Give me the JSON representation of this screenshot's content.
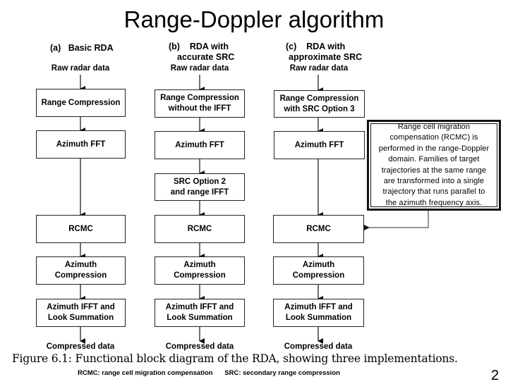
{
  "title": "Range-Doppler algorithm",
  "columns": [
    {
      "label_prefix": "(a)",
      "label_line1": "Basic RDA",
      "label_line2": "",
      "input": "Raw radar data",
      "steps": [
        "Range Compression",
        "Azimuth FFT",
        "RCMC",
        "Azimuth Compression",
        "Azimuth IFFT and Look Summation"
      ],
      "output": "Compressed data"
    },
    {
      "label_prefix": "(b)",
      "label_line1": "RDA with",
      "label_line2": "accurate SRC",
      "input": "Raw radar data",
      "steps": [
        "Range Compression without the IFFT",
        "Azimuth FFT",
        "SRC Option 2 and range IFFT",
        "RCMC",
        "Azimuth Compression",
        "Azimuth IFFT and Look Summation"
      ],
      "output": "Compressed data"
    },
    {
      "label_prefix": "(c)",
      "label_line1": "RDA with",
      "label_line2": "approximate SRC",
      "input": "Raw radar data",
      "steps": [
        "Range Compression with SRC Option 3",
        "Azimuth FFT",
        "RCMC",
        "Azimuth Compression",
        "Azimuth IFFT and Look Summation"
      ],
      "output": "Compressed data"
    }
  ],
  "boxes": {
    "a": {
      "range_compression": "Range Compression",
      "azimuth_fft": "Azimuth FFT",
      "rcmc": "RCMC",
      "azimuth_compression_1": "Azimuth",
      "azimuth_compression_2": "Compression",
      "ifft_1": "Azimuth IFFT and",
      "ifft_2": "Look Summation"
    },
    "b": {
      "range_compression_1": "Range Compression",
      "range_compression_2": "without the IFFT",
      "azimuth_fft": "Azimuth FFT",
      "src_1": "SRC Option 2",
      "src_2": "and range IFFT",
      "rcmc": "RCMC",
      "azimuth_compression_1": "Azimuth",
      "azimuth_compression_2": "Compression",
      "ifft_1": "Azimuth IFFT and",
      "ifft_2": "Look Summation"
    },
    "c": {
      "range_compression_1": "Range Compression",
      "range_compression_2": "with SRC Option 3",
      "azimuth_fft": "Azimuth FFT",
      "rcmc": "RCMC",
      "azimuth_compression_1": "Azimuth",
      "azimuth_compression_2": "Compression",
      "ifft_1": "Azimuth IFFT and",
      "ifft_2": "Look Summation"
    }
  },
  "callout": {
    "lines": [
      "Range cell migration",
      "compensation (RCMC) is",
      "performed in the range-Doppler",
      "domain.  Families of target",
      "trajectories at the same range",
      "are transformed into a single",
      "trajectory that runs parallel to",
      "the azimuth frequency axis."
    ]
  },
  "caption": "Figure 6.1: Functional block diagram of the RDA, showing three implementations.",
  "legend": {
    "rcmc": "RCMC:  range cell migration compensation",
    "src": "SRC:  secondary range compression"
  },
  "page_number": "2"
}
